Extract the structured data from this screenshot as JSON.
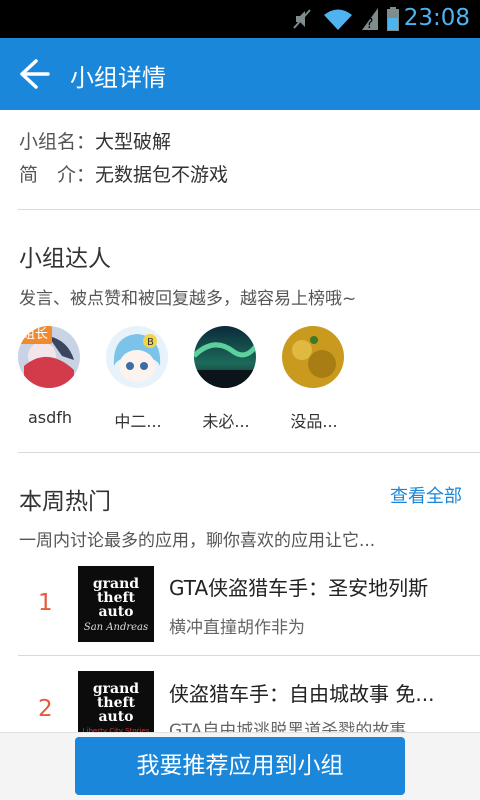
{
  "status_bar": {
    "time": "23:08"
  },
  "app_bar": {
    "title": "小组详情"
  },
  "group": {
    "name_key": "小组名：",
    "name_value": "大型破解",
    "intro_key": "简　介：",
    "intro_value": "无数据包不游戏"
  },
  "experts_section": {
    "title": "小组达人",
    "desc": "发言、被点赞和被回复越多，越容易上榜哦~",
    "leader_badge": "组长",
    "members": [
      {
        "name": "asdfh"
      },
      {
        "name": "中二..."
      },
      {
        "name": "未必..."
      },
      {
        "name": "没品..."
      }
    ]
  },
  "hot_section": {
    "title": "本周热门",
    "see_all": "查看全部",
    "desc": "一周内讨论最多的应用，聊你喜欢的应用让它...",
    "apps": [
      {
        "rank": "1",
        "name": "GTA侠盗猎车手：圣安地列斯",
        "desc": "横冲直撞胡作非为",
        "icon_lines": [
          "grand",
          "theft",
          "auto"
        ],
        "icon_sub": "San Andreas"
      },
      {
        "rank": "2",
        "name": "侠盗猎车手：自由城故事 免...",
        "desc": "GTA自由城逃脱黑道杀戮的故事",
        "icon_lines": [
          "grand",
          "theft",
          "auto"
        ],
        "icon_sub": "Liberty City Stories"
      }
    ]
  },
  "bottom": {
    "recommend_button": "我要推荐应用到小组"
  },
  "colors": {
    "primary": "#1a87db",
    "rank": "#e85a3c",
    "badge": "#f08a2c"
  }
}
